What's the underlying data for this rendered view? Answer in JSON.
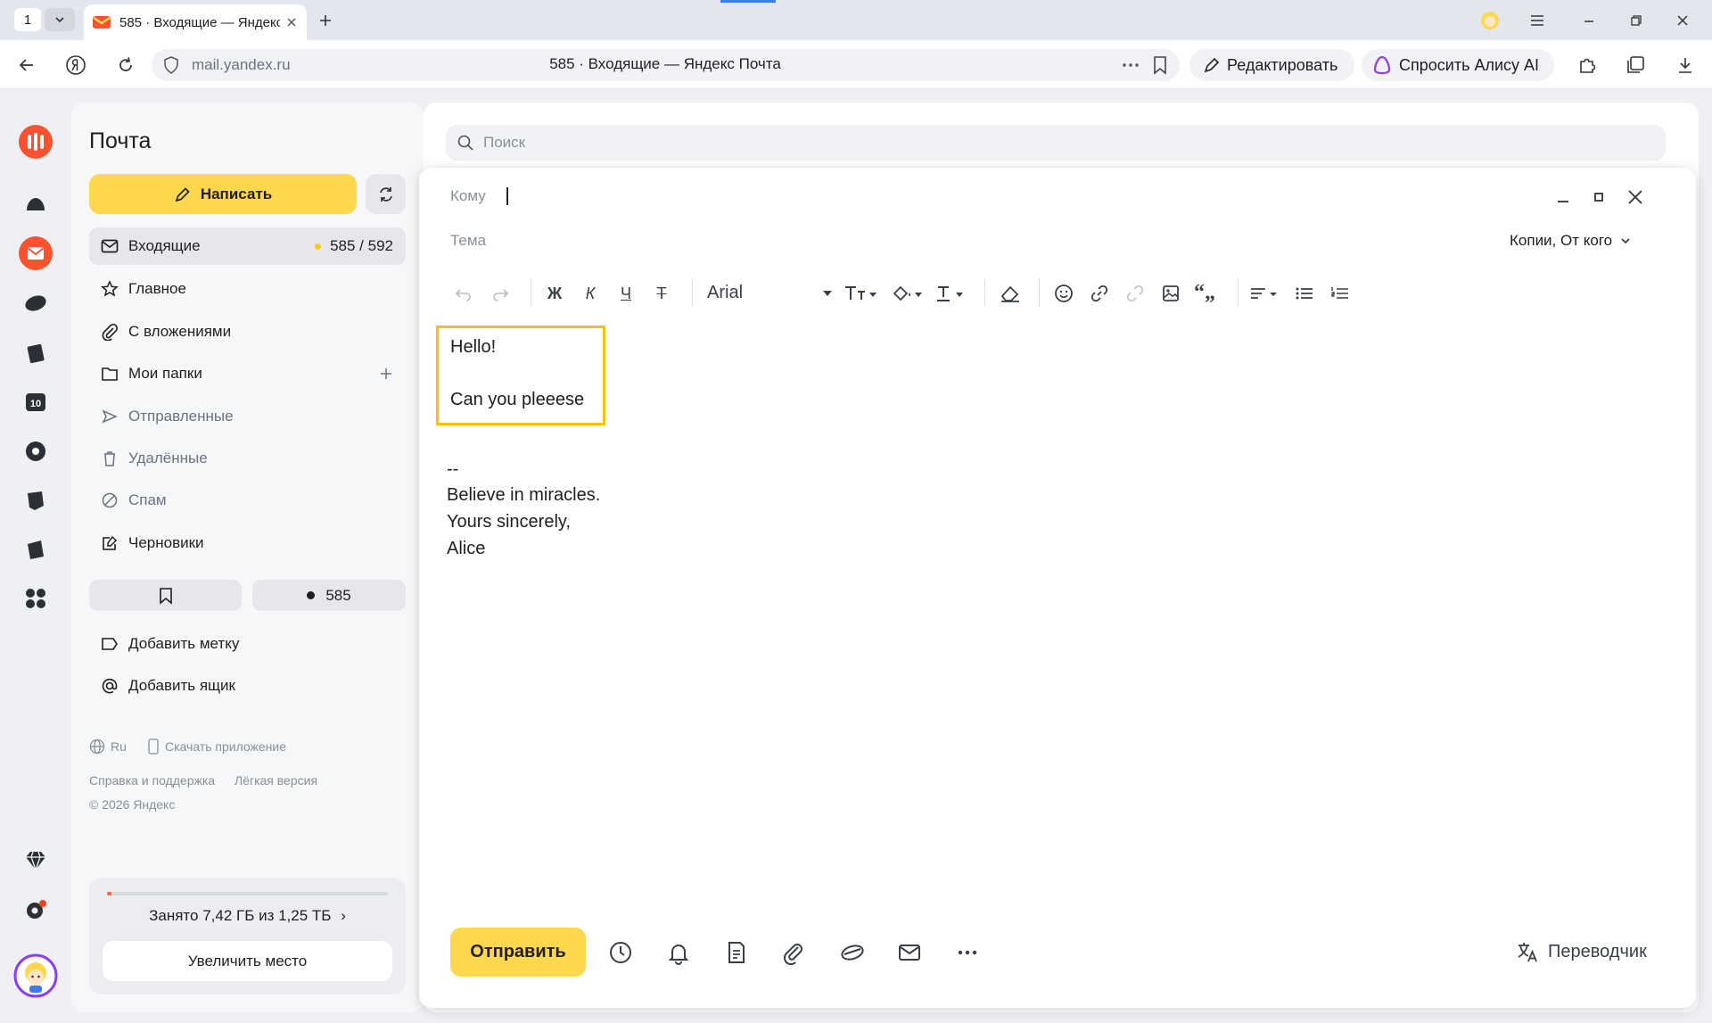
{
  "browser": {
    "tab_counter": "1",
    "tab_title": "585 · Входящие — Яндекс Почта",
    "url_host": "mail.yandex.ru",
    "page_title": "585 · Входящие — Яндекс Почта",
    "edit_label": "Редактировать",
    "alice_label": "Спросить Алису AI"
  },
  "sidebar": {
    "title": "Почта",
    "compose_label": "Написать",
    "inbox": {
      "label": "Входящие",
      "count": "585 / 592"
    },
    "items": [
      {
        "label": "Главное"
      },
      {
        "label": "С вложениями"
      },
      {
        "label": "Мои папки"
      },
      {
        "label": "Отправленные"
      },
      {
        "label": "Удалённые"
      },
      {
        "label": "Спам"
      },
      {
        "label": "Черновики"
      }
    ],
    "unread_pill": "585",
    "add_label": "Добавить метку",
    "add_mailbox": "Добавить ящик",
    "footer": {
      "lang": "Ru",
      "download_app": "Скачать приложение",
      "help": "Справка и поддержка",
      "lite": "Лёгкая версия",
      "copyright": "© 2026 Яндекс"
    },
    "storage": {
      "text": "Занято 7,42 ГБ из 1,25 ТБ",
      "used_fraction": 0.006,
      "increase_label": "Увеличить место"
    }
  },
  "search": {
    "placeholder": "Поиск"
  },
  "compose": {
    "to_label": "Кому",
    "subject_label": "Тема",
    "copies_label": "Копии, От кого",
    "font_family": "Arial",
    "bold": "Ж",
    "italic": "К",
    "underline": "Ч",
    "strike": "Т",
    "body": [
      "Hello!",
      "Can you pleeese"
    ],
    "signature": [
      "--",
      "Believe in miracles.",
      "Yours sincerely,",
      "Alice"
    ],
    "send_label": "Отправить",
    "translator_label": "Переводчик"
  },
  "colors": {
    "accent_yellow": "#ffd84e",
    "highlight": "#ffc107",
    "mail_red": "#fc5230"
  }
}
